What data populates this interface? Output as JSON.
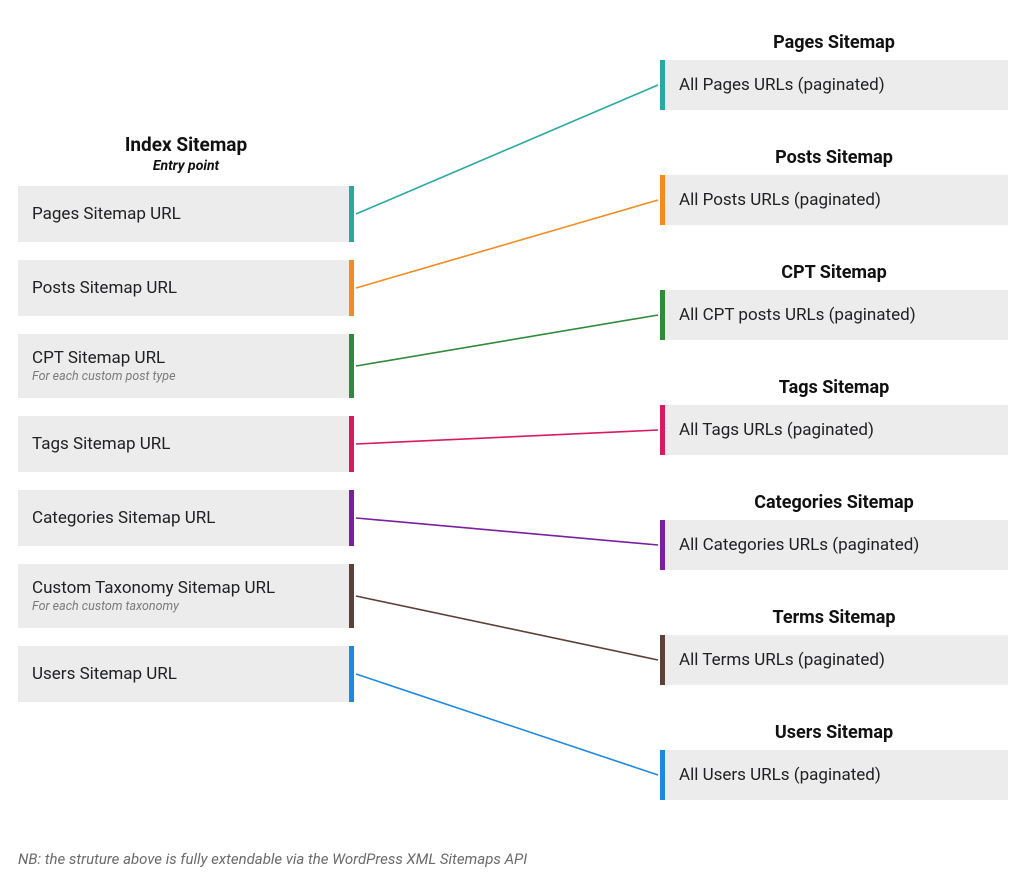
{
  "index": {
    "title": "Index Sitemap",
    "subtitle": "Entry point",
    "items": [
      {
        "label": "Pages Sitemap URL",
        "sublabel": null
      },
      {
        "label": "Posts Sitemap URL",
        "sublabel": null
      },
      {
        "label": "CPT Sitemap URL",
        "sublabel": "For each custom post type"
      },
      {
        "label": "Tags Sitemap URL",
        "sublabel": null
      },
      {
        "label": "Categories Sitemap URL",
        "sublabel": null
      },
      {
        "label": "Custom Taxonomy Sitemap URL",
        "sublabel": "For each custom taxonomy"
      },
      {
        "label": "Users Sitemap URL",
        "sublabel": null
      }
    ]
  },
  "destinations": [
    {
      "title": "Pages Sitemap",
      "desc": "All Pages URLs (paginated)"
    },
    {
      "title": "Posts Sitemap",
      "desc": "All Posts URLs (paginated)"
    },
    {
      "title": "CPT Sitemap",
      "desc": "All CPT posts URLs (paginated)"
    },
    {
      "title": "Tags Sitemap",
      "desc": "All Tags URLs (paginated)"
    },
    {
      "title": "Categories Sitemap",
      "desc": "All Categories URLs (paginated)"
    },
    {
      "title": "Terms Sitemap",
      "desc": "All Terms URLs (paginated)"
    },
    {
      "title": "Users Sitemap",
      "desc": "All Users URLs (paginated)"
    }
  ],
  "colors": {
    "teal": "#2aa9a3",
    "orange": "#f58a1f",
    "green": "#2e8b3a",
    "pink": "#d81b60",
    "purple": "#7b1fa2",
    "brown": "#5d4037",
    "blue": "#1e88e5"
  },
  "footnote": "NB: the struture above is fully extendable via the WordPress XML Sitemaps API"
}
